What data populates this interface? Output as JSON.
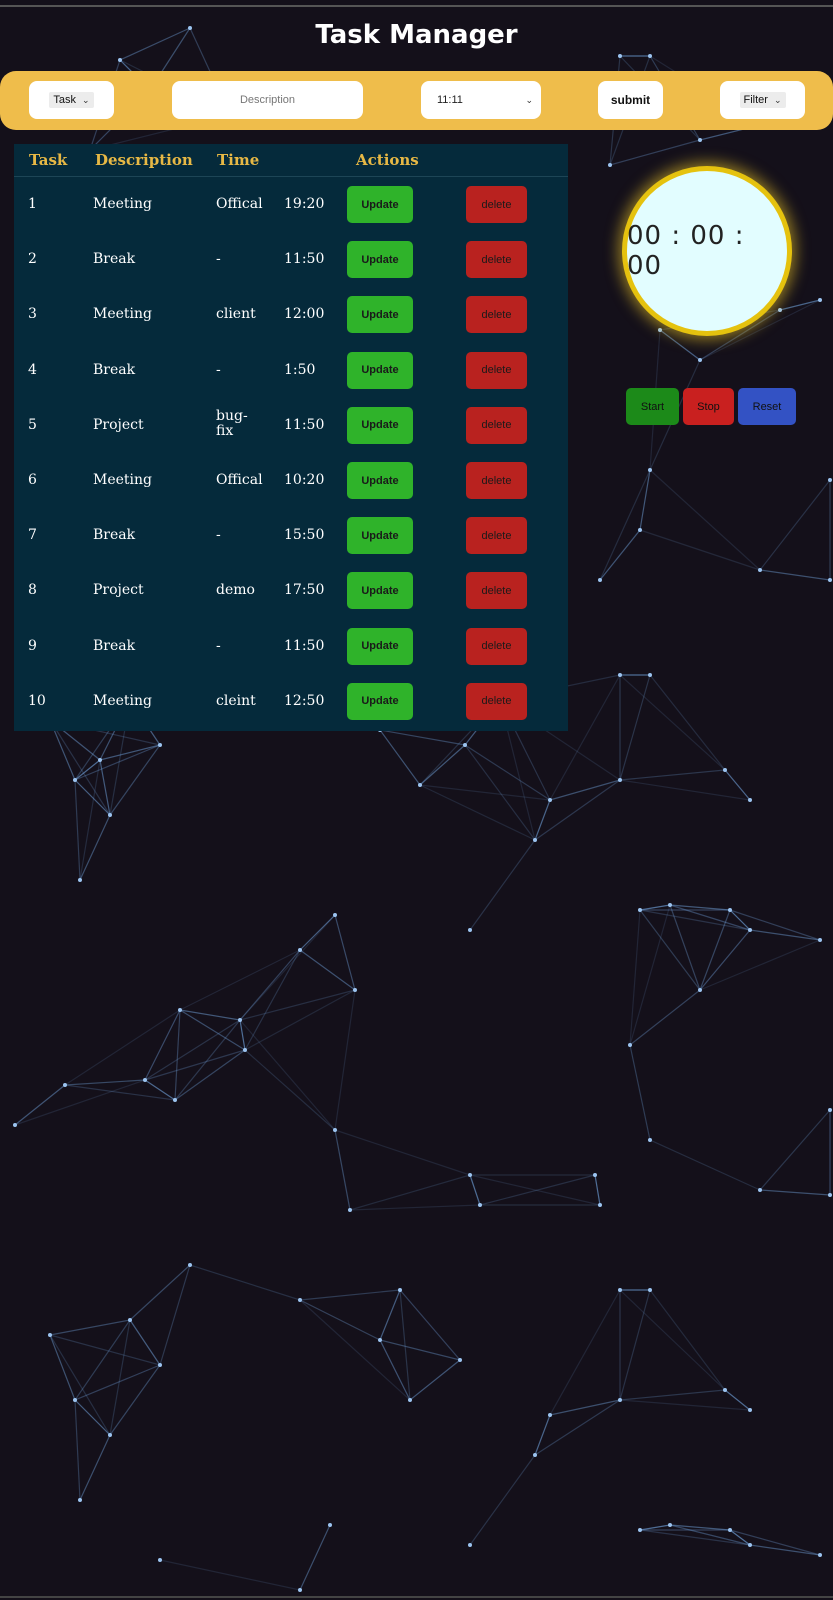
{
  "app": {
    "title": "Task Manager"
  },
  "toolbar": {
    "task_select": "Task",
    "description_placeholder": "Description",
    "time_select": "11:11",
    "submit_label": "submit",
    "filter_select": "Filter"
  },
  "table": {
    "headers": {
      "task": "Task",
      "description": "Description",
      "time": "Time",
      "actions": "Actions"
    },
    "update_label": "Update",
    "delete_label": "delete",
    "rows": [
      {
        "task": "1",
        "description": "Meeting",
        "note": "Offical",
        "time": "19:20"
      },
      {
        "task": "2",
        "description": "Break",
        "note": "-",
        "time": "11:50"
      },
      {
        "task": "3",
        "description": "Meeting",
        "note": "client",
        "time": "12:00"
      },
      {
        "task": "4",
        "description": "Break",
        "note": "-",
        "time": "1:50"
      },
      {
        "task": "5",
        "description": "Project",
        "note": "bug-fix",
        "time": "11:50"
      },
      {
        "task": "6",
        "description": "Meeting",
        "note": "Offical",
        "time": "10:20"
      },
      {
        "task": "7",
        "description": "Break",
        "note": "-",
        "time": "15:50"
      },
      {
        "task": "8",
        "description": "Project",
        "note": "demo",
        "time": "17:50"
      },
      {
        "task": "9",
        "description": "Break",
        "note": "-",
        "time": "11:50"
      },
      {
        "task": "10",
        "description": "Meeting",
        "note": "cleint",
        "time": "12:50"
      }
    ]
  },
  "stopwatch": {
    "display": "00 : 00 : 00",
    "start_label": "Start",
    "stop_label": "Stop",
    "reset_label": "Reset"
  },
  "colors": {
    "background": "#14101a",
    "toolbar": "#efbd4b",
    "table_bg": "#052a3b",
    "header_text": "#e7b845",
    "update": "#2fb32a",
    "delete": "#b9221f",
    "start": "#1c8a19",
    "stop": "#c9201f",
    "reset": "#3352c4",
    "clock_ring": "#e5c20e",
    "network": "#6f9fd8"
  }
}
